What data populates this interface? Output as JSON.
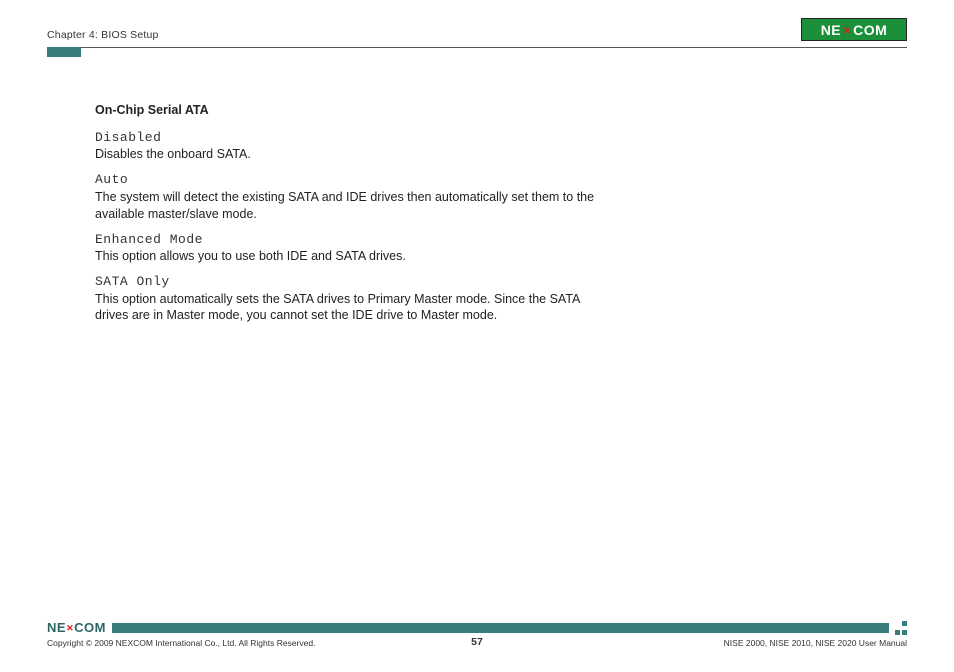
{
  "header": {
    "chapter": "Chapter 4: BIOS Setup",
    "brand_left": "NE",
    "brand_right": "COM"
  },
  "content": {
    "section_title": "On-Chip Serial ATA",
    "options": [
      {
        "name": "Disabled",
        "desc": "Disables the onboard SATA."
      },
      {
        "name": "Auto",
        "desc": "The system will detect the existing SATA and IDE drives then automatically set them to the available master/slave mode."
      },
      {
        "name": "Enhanced Mode",
        "desc": "This option allows you to use both IDE and SATA drives."
      },
      {
        "name": "SATA Only",
        "desc": "This option automatically sets the SATA drives to Primary Master mode. Since the SATA drives are in Master mode, you cannot set the IDE drive to Master mode."
      }
    ]
  },
  "footer": {
    "brand_left": "NE",
    "brand_right": "COM",
    "copyright": "Copyright © 2009 NEXCOM International Co., Ltd. All Rights Reserved.",
    "page_number": "57",
    "doc_ref": "NISE 2000, NISE 2010, NISE 2020 User Manual"
  }
}
